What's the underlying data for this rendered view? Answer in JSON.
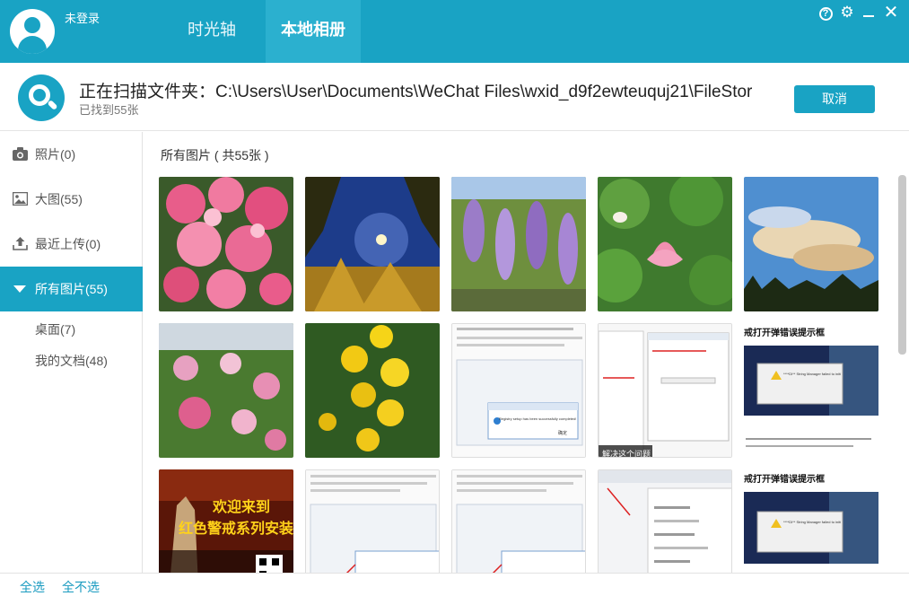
{
  "header": {
    "user_status": "未登录",
    "tabs": [
      {
        "label": "时光轴",
        "active": false
      },
      {
        "label": "本地相册",
        "active": true
      }
    ],
    "accent_color": "#19a3c4",
    "window_controls": [
      "help-icon",
      "gear-icon",
      "minimize-icon",
      "close-icon"
    ]
  },
  "scan": {
    "title": "正在扫描文件夹：C:\\Users\\User\\Documents\\WeChat Files\\wxid_d9f2ewteuquj21\\FileStor",
    "found": "已找到55张",
    "cancel_label": "取消"
  },
  "sidebar": {
    "items": [
      {
        "label": "照片(0)",
        "icon": "camera-icon"
      },
      {
        "label": "大图(55)",
        "icon": "image-icon"
      },
      {
        "label": "最近上传(0)",
        "icon": "upload-icon"
      },
      {
        "label": "所有图片(55)",
        "icon": "caret-down-icon",
        "active": true
      }
    ],
    "subitems": [
      {
        "label": "桌面(7)"
      },
      {
        "label": "我的文档(48)"
      }
    ]
  },
  "main": {
    "section_title": "所有图片 ( 共55张 )",
    "screenshot_texts": {
      "dialog_title": "Registry setup has been successfully completed!",
      "ok": "确定",
      "tip": "解决这个问题",
      "error_title": "戒打开弹错误提示框",
      "error_msg": "****DI** String Manager failed to initialized properly",
      "game_banner_1": "欢迎来到",
      "game_banner_2": "红色警戒系列安装"
    }
  },
  "footer": {
    "select_all": "全选",
    "select_none": "全不选"
  }
}
